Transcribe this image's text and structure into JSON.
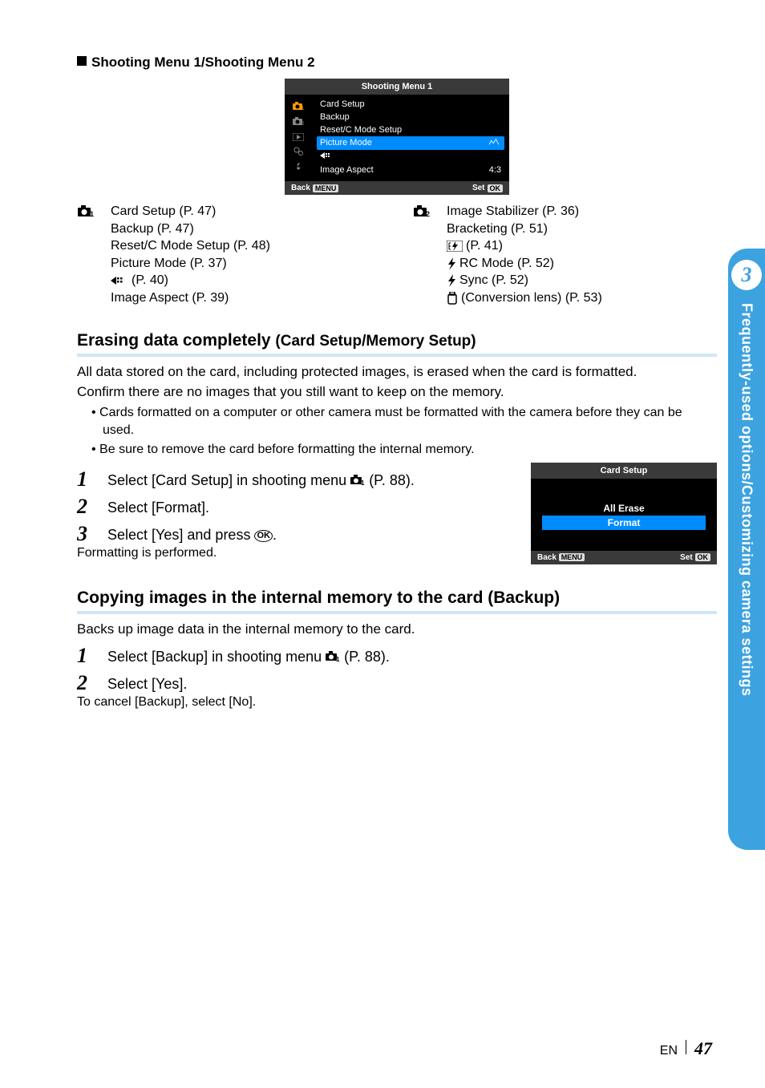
{
  "section_title": "Shooting Menu 1/Shooting Menu 2",
  "menu1": {
    "title": "Shooting Menu 1",
    "items": [
      {
        "label": "Card Setup",
        "value": ""
      },
      {
        "label": "Backup",
        "value": ""
      },
      {
        "label": "Reset/C Mode Setup",
        "value": ""
      },
      {
        "label": "Picture Mode",
        "value": "",
        "highlight": true,
        "icon_right": "natural"
      },
      {
        "label": "",
        "value": "",
        "icon_left": "record"
      },
      {
        "label": "Image Aspect",
        "value": "4:3"
      }
    ],
    "footer_back": "Back",
    "footer_back_pill": "MENU",
    "footer_set": "Set",
    "footer_set_pill": "OK"
  },
  "col1_head": "W",
  "col1": [
    "Card Setup (P. 47)",
    "Backup (P. 47)",
    "Reset/C Mode Setup (P. 48)",
    "Picture Mode (P. 37)",
    " (P. 40)",
    "Image Aspect (P. 39)"
  ],
  "col1_icon_index": 4,
  "col2_head": "X",
  "col2": [
    "Image Stabilizer (P. 36)",
    "Bracketing (P. 51)",
    " (P. 41)",
    "RC Mode (P. 52)",
    " Sync (P. 52)",
    " (Conversion lens) (P. 53)"
  ],
  "col2_icons": {
    "2": "flashbox",
    "3": "flash",
    "4": "flash",
    "5": "lens"
  },
  "erase": {
    "heading_main": "Erasing data completely ",
    "heading_paren": "(Card Setup/Memory Setup)",
    "para1": "All data stored on the card, including protected images, is erased when the card is formatted.",
    "para2": "Confirm there are no images that you still want to keep on the memory.",
    "b1": "Cards formatted on a computer or other camera must be formatted with the camera before they can be used.",
    "b2": "Be sure to remove the card before formatting the internal memory.",
    "step1a": "Select [Card Setup] in shooting menu ",
    "step1b": " (P. 88).",
    "step2": "Select [Format].",
    "step3a": "Select [Yes] and press ",
    "step3b": ".",
    "step3_sub": "Formatting is performed."
  },
  "cardsetup_dialog": {
    "title": "Card Setup",
    "opt1": "All Erase",
    "opt2": "Format",
    "back": "Back",
    "back_pill": "MENU",
    "set": "Set",
    "set_pill": "OK"
  },
  "backup": {
    "heading": "Copying images in the internal memory to the card (Backup)",
    "para": "Backs up image data in the internal memory to the card.",
    "step1a": "Select [Backup] in shooting menu ",
    "step1b": " (P. 88).",
    "step2": "Select [Yes].",
    "step2_sub": "To cancel [Backup],  select [No]."
  },
  "sidetab": {
    "num": "3",
    "text": "Frequently-used options/Customizing camera settings"
  },
  "footer": {
    "lang": "EN",
    "page": "47"
  }
}
